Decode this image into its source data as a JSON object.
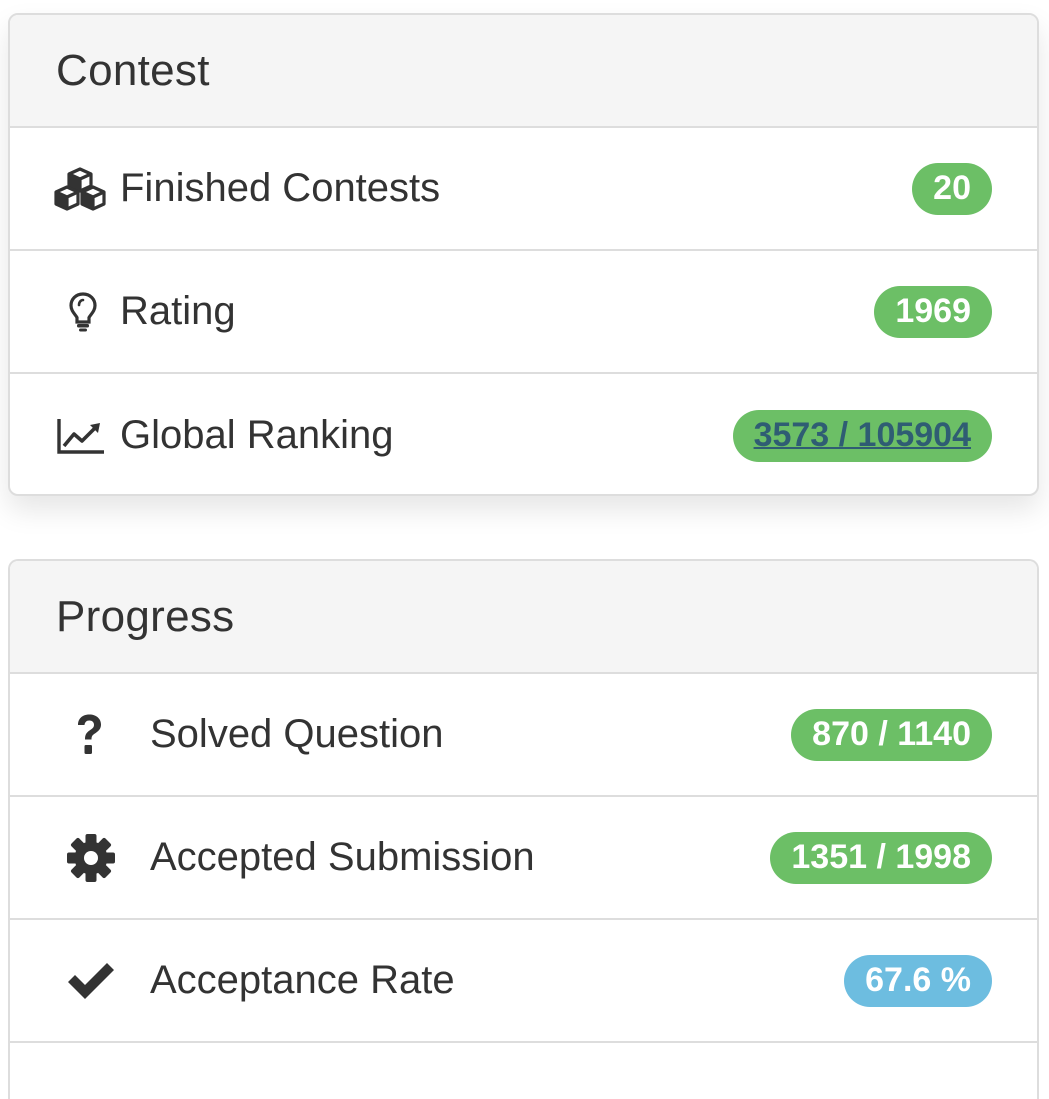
{
  "contest": {
    "title": "Contest",
    "items": [
      {
        "icon": "cubes-icon",
        "label": "Finished Contests",
        "value": "20",
        "badge_color": "#6cbf66"
      },
      {
        "icon": "lightbulb-icon",
        "label": "Rating",
        "value": "1969",
        "badge_color": "#6cbf66"
      },
      {
        "icon": "line-chart-icon",
        "label": "Global Ranking",
        "value": "3573 / 105904",
        "badge_color": "#6cbf66",
        "link_color": "#2f5d73"
      }
    ]
  },
  "progress": {
    "title": "Progress",
    "items": [
      {
        "icon": "question-icon",
        "label": "Solved Question",
        "value": "870 / 1140",
        "badge_color": "#6cbf66"
      },
      {
        "icon": "gear-icon",
        "label": "Accepted Submission",
        "value": "1351 / 1998",
        "badge_color": "#6cbf66"
      },
      {
        "icon": "check-icon",
        "label": "Acceptance Rate",
        "value": "67.6 %",
        "badge_color": "#6dbde0"
      }
    ]
  }
}
